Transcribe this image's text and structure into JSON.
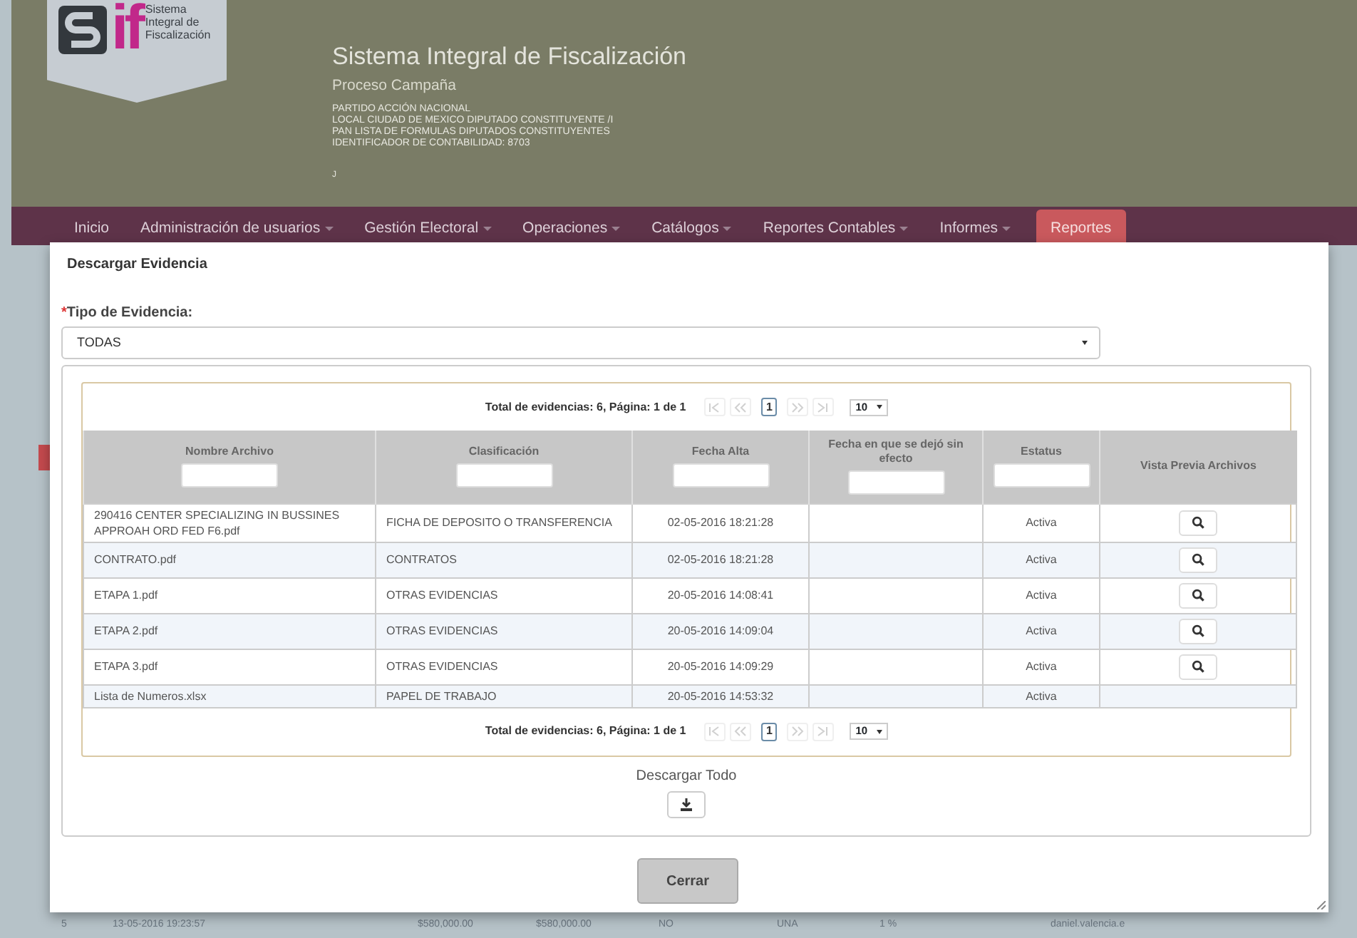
{
  "header": {
    "logo_mark": "if",
    "logo_text": [
      "Sistema",
      "Integral de",
      "Fiscalización"
    ],
    "title": "Sistema Integral de Fiscalización",
    "subtitle": "Proceso Campaña",
    "lines": [
      "PARTIDO ACCIÓN NACIONAL",
      "LOCAL CIUDAD DE MEXICO DIPUTADO CONSTITUYENTE /I",
      "PAN LISTA DE FORMULAS DIPUTADOS CONSTITUYENTES",
      "IDENTIFICADOR DE CONTABILIDAD: 8703"
    ],
    "footnote": "J"
  },
  "nav": {
    "items": [
      {
        "label": "Inicio",
        "dropdown": false,
        "selected": false
      },
      {
        "label": "Administración de usuarios",
        "dropdown": true,
        "selected": false
      },
      {
        "label": "Gestión Electoral",
        "dropdown": true,
        "selected": false
      },
      {
        "label": "Operaciones",
        "dropdown": true,
        "selected": false
      },
      {
        "label": "Catálogos",
        "dropdown": true,
        "selected": false
      },
      {
        "label": "Reportes Contables",
        "dropdown": true,
        "selected": false
      },
      {
        "label": "Informes",
        "dropdown": true,
        "selected": false
      },
      {
        "label": "Reportes",
        "dropdown": false,
        "selected": true
      }
    ]
  },
  "background_row": [
    "5",
    "13-05-2016 19:23:57",
    "$580,000.00",
    "$580,000.00",
    "NO",
    "UNA",
    "1 %",
    "daniel.valencia.e"
  ],
  "modal": {
    "title": "Descargar Evidencia",
    "field": {
      "required_mark": "*",
      "label": "Tipo de Evidencia:",
      "value": "TODAS"
    },
    "pager_top": {
      "summary": "Total de evidencias: 6, Página: 1 de 1",
      "nav_buttons": [
        {
          "kind": "first",
          "disabled": true
        },
        {
          "kind": "prev",
          "disabled": true
        },
        {
          "kind": "page",
          "label": "1",
          "selected": true
        },
        {
          "kind": "next",
          "disabled": true
        },
        {
          "kind": "last",
          "disabled": true
        }
      ],
      "page_size": "10"
    },
    "table": {
      "columns": [
        {
          "label": "Nombre Archivo",
          "filter": true
        },
        {
          "label": "Clasificación",
          "filter": true
        },
        {
          "label": "Fecha Alta",
          "filter": true
        },
        {
          "label": "Fecha en que se dejó sin efecto",
          "filter": true
        },
        {
          "label": "Estatus",
          "filter": true
        },
        {
          "label": "Vista Previa Archivos",
          "filter": false
        }
      ],
      "rows": [
        {
          "cells": [
            "290416 CENTER SPECIALIZING IN BUSSINES APPROAH ORD FED F6.pdf",
            "FICHA DE DEPOSITO O TRANSFERENCIA",
            "02-05-2016 18:21:28",
            "",
            "Activa"
          ],
          "preview": true
        },
        {
          "cells": [
            "CONTRATO.pdf",
            "CONTRATOS",
            "02-05-2016 18:21:28",
            "",
            "Activa"
          ],
          "preview": true
        },
        {
          "cells": [
            "ETAPA 1.pdf",
            "OTRAS EVIDENCIAS",
            "20-05-2016 14:08:41",
            "",
            "Activa"
          ],
          "preview": true
        },
        {
          "cells": [
            "ETAPA 2.pdf",
            "OTRAS EVIDENCIAS",
            "20-05-2016 14:09:04",
            "",
            "Activa"
          ],
          "preview": true
        },
        {
          "cells": [
            "ETAPA 3.pdf",
            "OTRAS EVIDENCIAS",
            "20-05-2016 14:09:29",
            "",
            "Activa"
          ],
          "preview": true
        },
        {
          "cells": [
            "Lista de Numeros.xlsx",
            "PAPEL DE TRABAJO",
            "20-05-2016 14:53:32",
            "",
            "Activa"
          ],
          "preview": false
        }
      ]
    },
    "pager_bottom": {
      "summary": "Total de evidencias: 6, Página: 1 de 1",
      "nav_buttons": [
        {
          "kind": "first",
          "disabled": true
        },
        {
          "kind": "prev",
          "disabled": true
        },
        {
          "kind": "page",
          "label": "1",
          "selected": true
        },
        {
          "kind": "next",
          "disabled": true
        },
        {
          "kind": "last",
          "disabled": true
        }
      ],
      "page_size": "10"
    },
    "download_all": "Descargar Todo",
    "close": "Cerrar"
  }
}
